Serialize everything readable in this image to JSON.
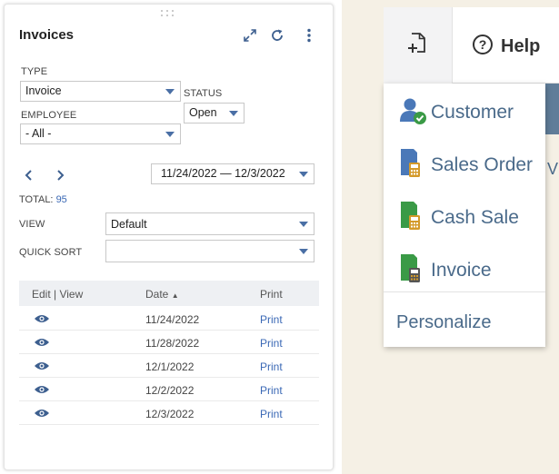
{
  "portlet": {
    "title": "Invoices",
    "type_label": "TYPE",
    "type_value": "Invoice",
    "status_label": "STATUS",
    "status_value": "Open",
    "employee_label": "EMPLOYEE",
    "employee_value": "- All -",
    "date_range": "11/24/2022 — 12/3/2022",
    "total_label": "TOTAL:",
    "total_value": "95",
    "view_label": "VIEW",
    "view_value": "Default",
    "quicksort_label": "QUICK SORT",
    "quicksort_value": "",
    "columns": [
      "Edit | View",
      "Date",
      "Print"
    ],
    "sort_indicator": "▲",
    "rows": [
      {
        "date": "11/24/2022",
        "print": "Print"
      },
      {
        "date": "11/28/2022",
        "print": "Print"
      },
      {
        "date": "12/1/2022",
        "print": "Print"
      },
      {
        "date": "12/2/2022",
        "print": "Print"
      },
      {
        "date": "12/3/2022",
        "print": "Print"
      }
    ],
    "icons": [
      "expand-icon",
      "refresh-icon",
      "more-icon",
      "eye-icon",
      "chevron-left-icon",
      "chevron-right-icon"
    ]
  },
  "topbar": {
    "help_label": "Help",
    "icons": [
      "new-record-icon",
      "help-icon"
    ]
  },
  "menu": {
    "items": [
      {
        "label": "Customer",
        "icon": "customer-icon"
      },
      {
        "label": "Sales Order",
        "icon": "sales-order-icon"
      },
      {
        "label": "Cash Sale",
        "icon": "cash-sale-icon"
      },
      {
        "label": "Invoice",
        "icon": "invoice-icon"
      }
    ],
    "personalize_label": "Personalize",
    "side_text": "V"
  },
  "colors": {
    "link": "#3a68b5",
    "menu_text": "#4a6a8a",
    "accent_triangle": "#4a6fa5",
    "background_right": "#f5f0e5"
  }
}
